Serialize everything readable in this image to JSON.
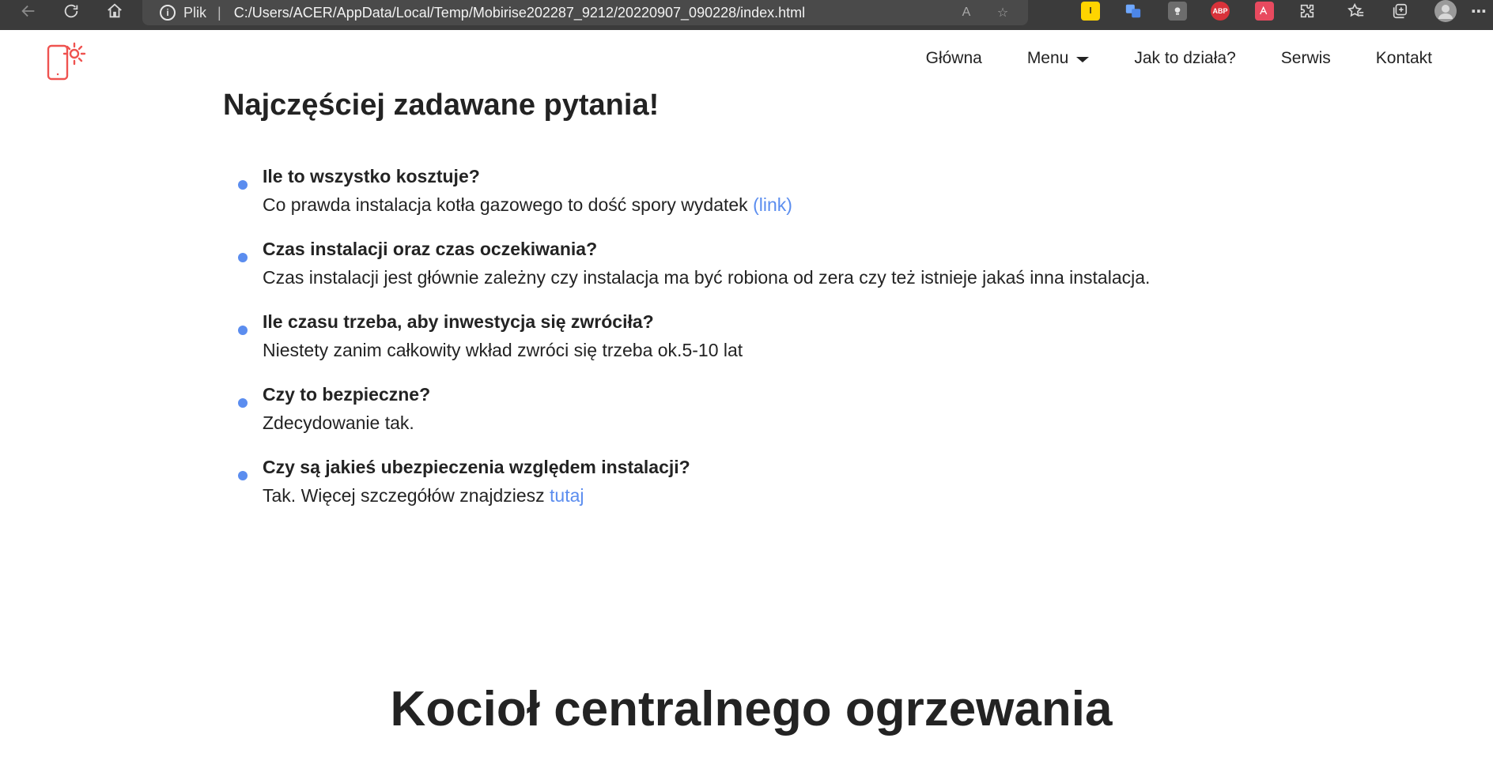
{
  "browser": {
    "address_label": "Plik",
    "address_separator": "|",
    "url": "C:/Users/ACER/AppData/Local/Temp/Mobirise202287_9212/20220907_090228/index.html",
    "extensions": {
      "ext1": "l",
      "ext4": "ABP"
    }
  },
  "nav": {
    "items": [
      {
        "label": "Główna"
      },
      {
        "label": "Menu"
      },
      {
        "label": "Jak to działa?"
      },
      {
        "label": "Serwis"
      },
      {
        "label": "Kontakt"
      }
    ]
  },
  "faq": {
    "title": "Najczęściej zadawane pytania!",
    "items": [
      {
        "question": "Ile to wszystko kosztuje?",
        "answer": "Co prawda instalacja kotła gazowego to dość spory wydatek",
        "link": "(link)"
      },
      {
        "question": "Czas instalacji oraz czas oczekiwania?",
        "answer": "Czas instalacji jest głównie zależny czy instalacja ma być robiona od zera czy też istnieje jakaś inna instalacja.",
        "link": ""
      },
      {
        "question": "Ile czasu trzeba, aby inwestycja się zwróciła?",
        "answer": "Niestety zanim całkowity wkład zwróci się trzeba ok.5-10 lat",
        "link": ""
      },
      {
        "question": "Czy to bezpieczne?",
        "answer": "Zdecydowanie tak.",
        "link": ""
      },
      {
        "question": "Czy są jakieś ubezpieczenia względem instalacji?",
        "answer": "Tak. Więcej szczegółów znajdziesz",
        "link": "tutaj"
      }
    ]
  },
  "section": {
    "title": "Kocioł centralnego ogrzewania"
  },
  "colors": {
    "accent": "#5b8def",
    "logo": "#ef5350",
    "text": "#232323",
    "browser_chrome": "#3b3b3b"
  }
}
